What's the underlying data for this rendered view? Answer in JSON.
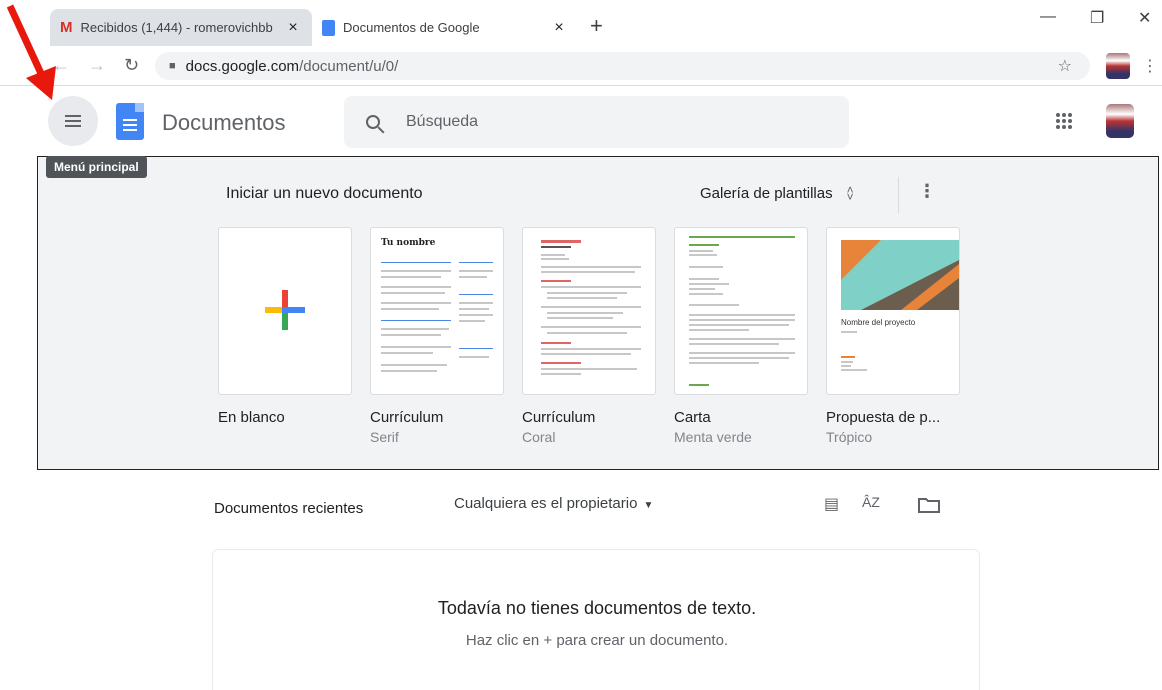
{
  "browser": {
    "tabs": [
      {
        "title": "Recibidos (1,444) - romerovichbb",
        "icon": "gmail-icon"
      },
      {
        "title": "Documentos de Google",
        "icon": "docs-icon"
      }
    ],
    "close_glyph": "×",
    "new_tab": "+",
    "url_host": "docs.google.com",
    "url_path": "/document/u/0/"
  },
  "header": {
    "app_name": "Documentos",
    "search_placeholder": "Búsqueda",
    "tooltip": "Menú principal"
  },
  "gallery": {
    "title": "Iniciar un nuevo documento",
    "template_gallery": "Galería de plantillas",
    "templates": [
      {
        "name": "En blanco",
        "subtitle": ""
      },
      {
        "name": "Currículum",
        "subtitle": "Serif",
        "preview_heading": "Tu nombre"
      },
      {
        "name": "Currículum",
        "subtitle": "Coral"
      },
      {
        "name": "Carta",
        "subtitle": "Menta verde"
      },
      {
        "name": "Propuesta de p...",
        "subtitle": "Trópico",
        "preview_heading": "Nombre del proyecto"
      }
    ]
  },
  "recent": {
    "title": "Documentos recientes",
    "owner_filter": "Cualquiera es el propietario",
    "empty_title": "Todavía no tienes documentos de texto.",
    "empty_hint": "Haz clic en + para crear un documento."
  },
  "colors": {
    "annotation_arrow": "#e8180c",
    "docs_blue": "#4285f4",
    "coral_accent": "#e06666",
    "mint_accent": "#6aa84f"
  }
}
